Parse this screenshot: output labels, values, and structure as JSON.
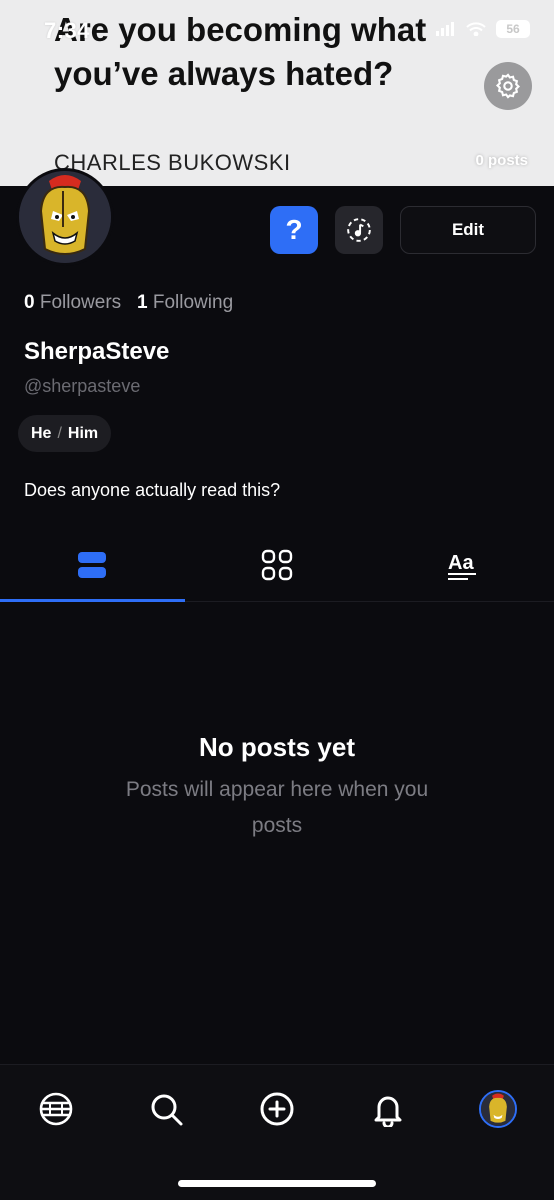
{
  "status_bar": {
    "time": "7:34",
    "battery": "56"
  },
  "banner": {
    "quote": "Are you becoming what you’ve always hated?",
    "author": "CHARLES BUKOWSKI",
    "posts_count": "0 posts"
  },
  "profile": {
    "followers_count": "0",
    "followers_label": "Followers",
    "following_count": "1",
    "following_label": "Following",
    "display_name": "SherpaSteve",
    "handle": "@sherpasteve",
    "pronoun_1": "He",
    "pronoun_sep": "/",
    "pronoun_2": "Him",
    "bio": "Does anyone actually read this?"
  },
  "actions": {
    "help_label": "?",
    "edit_label": "Edit"
  },
  "tabs": [
    {
      "icon": "posts-list-icon",
      "active": true
    },
    {
      "icon": "grid-icon",
      "active": false
    },
    {
      "icon": "text-icon",
      "active": false
    }
  ],
  "empty_state": {
    "title": "No posts yet",
    "subtitle": "Posts will appear here when you posts"
  },
  "bottom_nav": [
    "home-icon",
    "search-icon",
    "add-icon",
    "bell-icon",
    "profile-avatar"
  ],
  "colors": {
    "accent": "#2e6ef6",
    "background": "#0b0b0f",
    "banner": "#ececed"
  }
}
